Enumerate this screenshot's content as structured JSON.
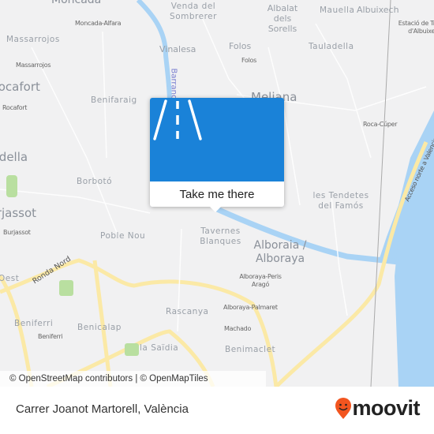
{
  "map": {
    "labels": {
      "moncada": "Moncada",
      "venda": "Venda del Sombrerer",
      "albalat": "Albalat dels Sorells",
      "mauella": "Mauella",
      "albuixech": "Albuixech",
      "estacio": "Estació de Tres d'Albuixech",
      "moncada_alfara": "Moncada-Alfara",
      "massarrojos_area": "Massarrojos",
      "massarrojos_stop": "Massarrojos",
      "vinalesa": "Vinalesa",
      "folos_area": "Folos",
      "folos_stop": "Folos",
      "tauladella": "Tauladella",
      "barranc": "Barranc",
      "rocafort_area": "Rocafort",
      "rocafort_stop": "Rocafort",
      "benifaraig": "Benifaraig",
      "meliana": "Meliana",
      "roca_cuper": "Roca-Cúper",
      "godella": "Godella",
      "acceso": "Acceso norte a Valencia",
      "borboto": "Borbotó",
      "tendetes": "les Tendetes del Famós",
      "burjassot_area": "Burjassot",
      "burjassot_stop": "Burjassot",
      "poble_nou": "Poble Nou",
      "tavernes": "Tavernes Blanques",
      "alboraia": "Alboraia / Alboraya",
      "ronda_nord": "Ronda Nord",
      "oest": "Oest",
      "alboraya_peris": "Alboraya-Peris Aragó",
      "alboraya_palmaret": "Alboraya-Palmaret",
      "rascanya": "Rascanya",
      "beniferri_area": "Beniferri",
      "beniferri_stop": "Beniferri",
      "benicalap": "Benicalap",
      "machado": "Machado",
      "la_saidia": "la Saïdia",
      "benimaclet": "Benimaclet"
    },
    "attribution": "© OpenStreetMap contributors | © OpenMapTiles",
    "colors": {
      "land": "#f1f1f2",
      "water": "#a9d3f5",
      "major_road": "#fbe9a6",
      "park": "#b9dfa0"
    }
  },
  "popup": {
    "icon": "road-icon",
    "button_label": "Take me there",
    "color": "#1a82d8"
  },
  "footer": {
    "address": "Carrer Joanot Martorell, València",
    "logo_text": "moovit",
    "logo_color": "#f2551f"
  }
}
